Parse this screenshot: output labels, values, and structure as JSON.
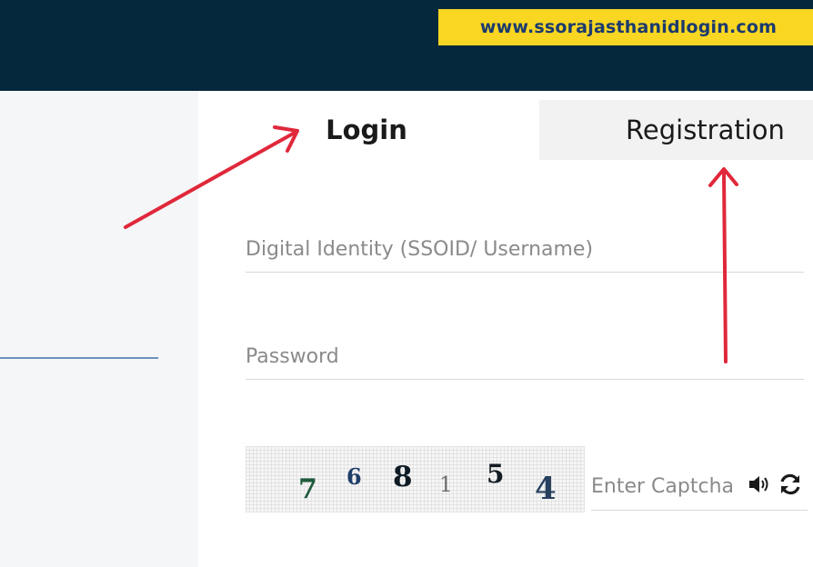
{
  "watermark": {
    "text": "www.ssorajasthanidlogin.com"
  },
  "tabs": {
    "login_label": "Login",
    "registration_label": "Registration"
  },
  "form": {
    "ssoid_placeholder": "Digital Identity (SSOID/ Username)",
    "password_placeholder": "Password",
    "captcha_placeholder": "Enter Captcha"
  },
  "captcha": {
    "chars": [
      "7",
      "6",
      "8",
      "1",
      "5",
      "4"
    ],
    "colors": [
      "#1e5a3c",
      "#1f3d68",
      "#0e1b24",
      "#6b6b6b",
      "#141d24",
      "#27405e"
    ]
  },
  "icons": [
    "speaker-icon",
    "refresh-icon",
    "arrow-icon"
  ],
  "colors": {
    "header": "#06283d",
    "watermark_bg": "#f8d622",
    "watermark_text": "#1b3a6e",
    "arrow": "#e0283b"
  }
}
